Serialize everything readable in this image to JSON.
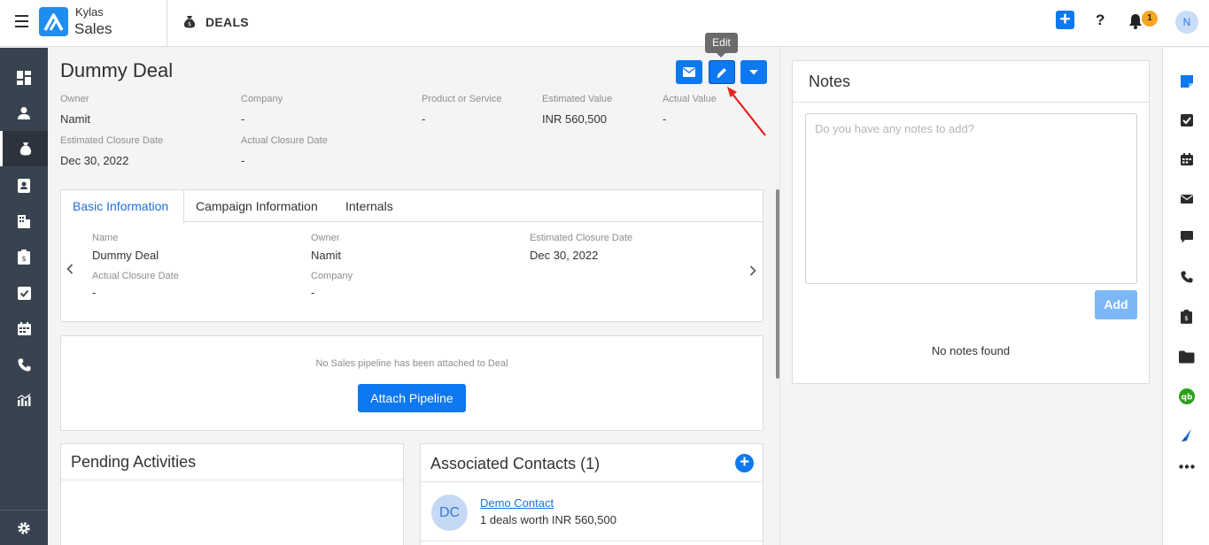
{
  "brand": {
    "line1": "Kylas",
    "line2": "Sales"
  },
  "header": {
    "module_title": "DEALS",
    "notification_count": "1",
    "user_initial": "N"
  },
  "deal": {
    "title": "Dummy Deal",
    "tooltip": "Edit",
    "fields": [
      {
        "label": "Owner",
        "value": "Namit"
      },
      {
        "label": "Company",
        "value": "-"
      },
      {
        "label": "Product or Service",
        "value": "-"
      },
      {
        "label": "Estimated Value",
        "value": "INR 560,500"
      },
      {
        "label": "Actual Value",
        "value": "-"
      },
      {
        "label": "Estimated Closure Date",
        "value": "Dec 30, 2022"
      },
      {
        "label": "Actual Closure Date",
        "value": "-"
      }
    ]
  },
  "tabs": [
    "Basic Information",
    "Campaign Information",
    "Internals"
  ],
  "basic_info": [
    {
      "label": "Name",
      "value": "Dummy Deal"
    },
    {
      "label": "Owner",
      "value": "Namit"
    },
    {
      "label": "Estimated Closure Date",
      "value": "Dec 30, 2022"
    },
    {
      "label": "Actual Closure Date",
      "value": "-"
    },
    {
      "label": "Company",
      "value": "-"
    }
  ],
  "pipeline": {
    "message": "No Sales pipeline has been attached to Deal",
    "button": "Attach Pipeline"
  },
  "pending": {
    "title": "Pending Activities"
  },
  "contacts": {
    "title": "Associated Contacts (1)",
    "items": [
      {
        "initials": "DC",
        "name": "Demo Contact",
        "summary": "1 deals worth INR 560,500"
      }
    ]
  },
  "notes": {
    "title": "Notes",
    "placeholder": "Do you have any notes to add?",
    "add_label": "Add",
    "empty": "No notes found"
  },
  "colors": {
    "primary": "#0d78ef",
    "sidebar": "#39434f",
    "badge": "#f5a623"
  }
}
